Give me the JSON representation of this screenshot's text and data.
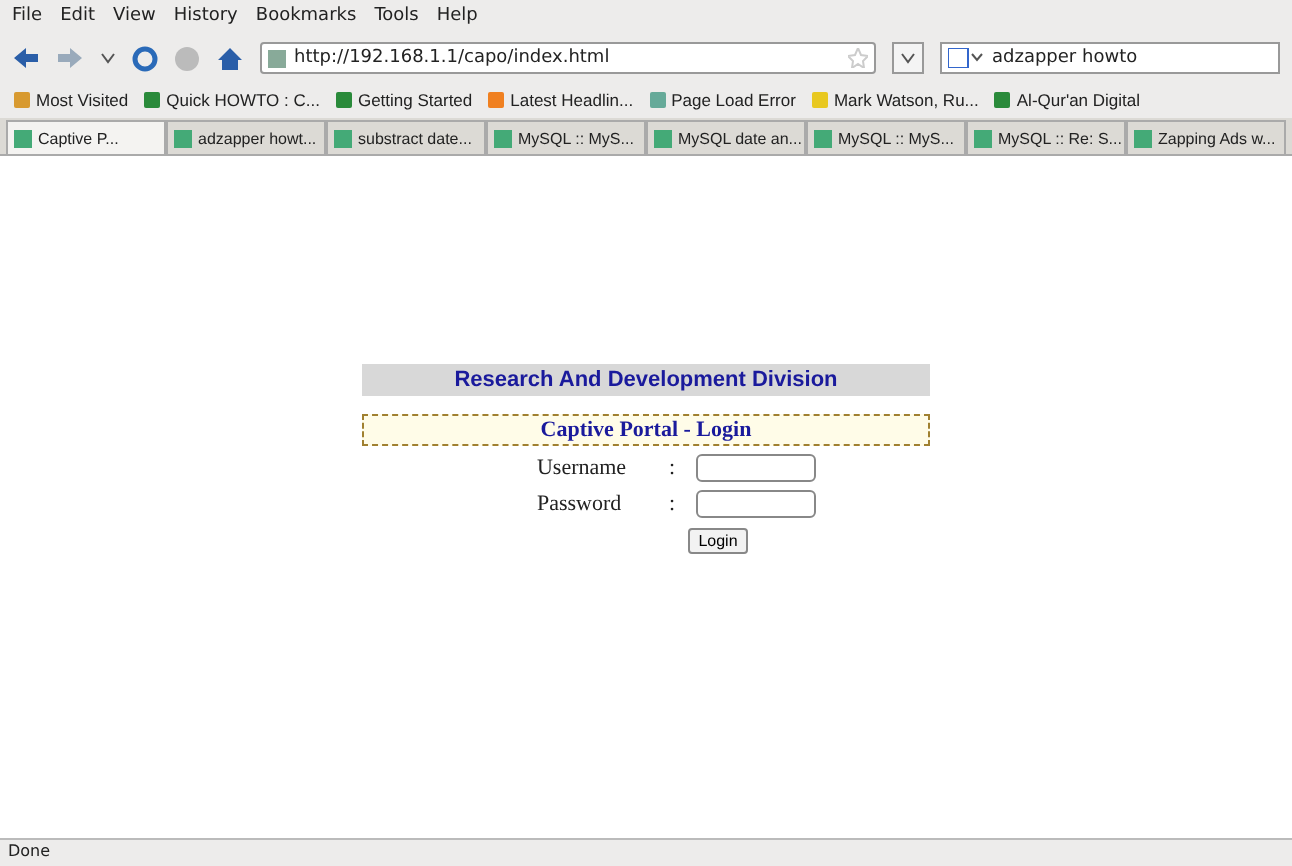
{
  "menu_bar": [
    "File",
    "Edit",
    "View",
    "History",
    "Bookmarks",
    "Tools",
    "Help"
  ],
  "nav": {
    "url": "http://192.168.1.1/capo/index.html",
    "search": "adzapper howto"
  },
  "bookmarks": [
    {
      "label": "Most Visited",
      "kind": "folder"
    },
    {
      "label": "Quick HOWTO : C...",
      "kind": "site"
    },
    {
      "label": "Getting Started",
      "kind": "site"
    },
    {
      "label": "Latest Headlin...",
      "kind": "feed"
    },
    {
      "label": "Page Load Error",
      "kind": "page"
    },
    {
      "label": "Mark Watson, Ru...",
      "kind": "idea"
    },
    {
      "label": "Al-Qur'an Digital",
      "kind": "site"
    }
  ],
  "tabs": [
    {
      "label": "Captive P...",
      "selected": true
    },
    {
      "label": "adzapper howt...",
      "selected": false
    },
    {
      "label": "substract date...",
      "selected": false
    },
    {
      "label": "MySQL :: MyS...",
      "selected": false
    },
    {
      "label": "MySQL date an...",
      "selected": false
    },
    {
      "label": "MySQL :: MyS...",
      "selected": false
    },
    {
      "label": "MySQL :: Re: S...",
      "selected": false
    },
    {
      "label": "Zapping Ads w...",
      "selected": false
    }
  ],
  "page": {
    "heading": "Research And Development Division",
    "form_title": "Captive Portal - Login",
    "fields": [
      {
        "label": "Username",
        "separator": ":"
      },
      {
        "label": "Password",
        "separator": ":"
      }
    ],
    "button": "Login"
  },
  "status_bar": "Done"
}
